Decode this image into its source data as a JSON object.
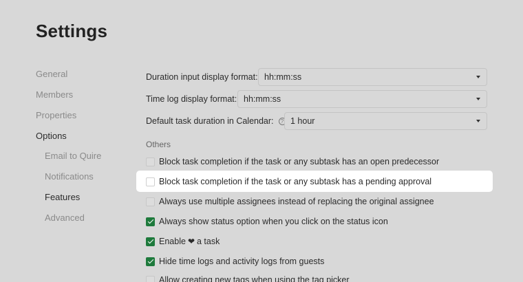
{
  "page": {
    "title": "Settings"
  },
  "sidebar": {
    "items": [
      {
        "label": "General",
        "level": 0,
        "active": false
      },
      {
        "label": "Members",
        "level": 0,
        "active": false
      },
      {
        "label": "Properties",
        "level": 0,
        "active": false
      },
      {
        "label": "Options",
        "level": 0,
        "active": true
      },
      {
        "label": "Email to Quire",
        "level": 1,
        "active": false
      },
      {
        "label": "Notifications",
        "level": 1,
        "active": false
      },
      {
        "label": "Features",
        "level": 1,
        "active": true
      },
      {
        "label": "Advanced",
        "level": 1,
        "active": false
      }
    ]
  },
  "settings": {
    "duration_format": {
      "label": "Duration input display format:",
      "value": "hh:mm:ss"
    },
    "timelog_format": {
      "label": "Time log display format:",
      "value": "hh:mm:ss"
    },
    "default_duration": {
      "label": "Default task duration in Calendar:",
      "value": "1 hour",
      "help_icon": "question-circle-icon"
    }
  },
  "others": {
    "title": "Others",
    "options": [
      {
        "label": "Block task completion if the task or any subtask has an open predecessor",
        "checked": false
      },
      {
        "label": "Block task completion if the task or any subtask has a pending approval",
        "checked": false,
        "highlighted": true
      },
      {
        "label": "Always use multiple assignees instead of replacing the original assignee",
        "checked": false
      },
      {
        "label": "Always show status option when you click on the status icon",
        "checked": true
      },
      {
        "label_before": "Enable",
        "label_after": "a task",
        "icon": "heart-icon",
        "checked": true
      },
      {
        "label": "Hide time logs and activity logs from guests",
        "checked": true
      },
      {
        "label": "Allow creating new tags when using the tag picker",
        "checked": false
      }
    ]
  },
  "colors": {
    "background": "#d8d8d8",
    "check_green": "#1e7a3c",
    "highlight": "#ffffff"
  }
}
